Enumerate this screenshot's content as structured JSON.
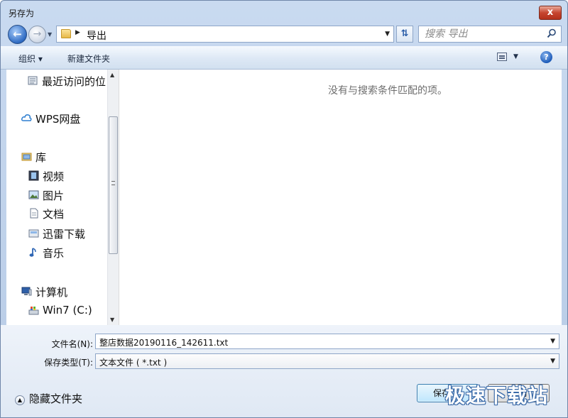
{
  "window": {
    "title": "另存为",
    "close_label": "x"
  },
  "address_bar": {
    "crumb": "导出"
  },
  "search": {
    "placeholder": "搜索 导出"
  },
  "toolbar": {
    "organize": "组织 ▾",
    "new_folder": "新建文件夹"
  },
  "nav_pane": {
    "items": [
      {
        "label": "最近访问的位",
        "icon": "recent-places-icon"
      },
      {
        "label": "WPS网盘",
        "icon": "cloud-icon"
      },
      {
        "label": "库",
        "icon": "library-icon"
      },
      {
        "label": "视频",
        "icon": "video-icon"
      },
      {
        "label": "图片",
        "icon": "picture-icon"
      },
      {
        "label": "文档",
        "icon": "document-icon"
      },
      {
        "label": "迅雷下载",
        "icon": "download-icon"
      },
      {
        "label": "音乐",
        "icon": "music-icon"
      },
      {
        "label": "计算机",
        "icon": "computer-icon"
      },
      {
        "label": "Win7 (C:)",
        "icon": "drive-icon"
      }
    ]
  },
  "file_pane": {
    "empty_message": "没有与搜索条件匹配的项。"
  },
  "form": {
    "filename_label": "文件名(N):",
    "filename_value": "整店数据20190116_142611.txt",
    "filetype_label": "保存类型(T):",
    "filetype_value": "文本文件 ( *.txt )"
  },
  "footer": {
    "hide_folders": "隐藏文件夹",
    "save_label": "保存(S)",
    "cancel_label": "取消"
  },
  "watermark": "极速下载站",
  "colors": {
    "accent": "#2f6bc3",
    "close": "#c6452f"
  }
}
